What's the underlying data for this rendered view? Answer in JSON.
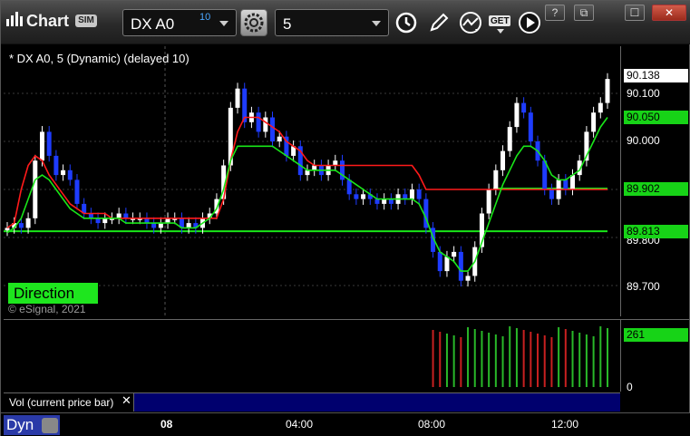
{
  "toolbar": {
    "title": "Chart",
    "sim_badge": "SIM",
    "symbol": "DX A0",
    "symbol_badge": "10",
    "interval": "5",
    "get_label": "GET",
    "window_buttons": [
      "?",
      "⧉",
      "☐",
      "✕"
    ]
  },
  "chart": {
    "label": "* DX A0, 5 (Dynamic) (delayed 10)",
    "copyright": "© eSignal, 2021",
    "direction_label": "Direction",
    "colors": {
      "up_bar": "#ffffff",
      "down_bar": "#1e3cff",
      "red_line": "#ff1a1a",
      "green_line": "#19e619",
      "grid": "#3a3a3a",
      "tag_green": "#17d317"
    }
  },
  "price_axis": {
    "ticks": [
      "90.100",
      "90.000",
      "89.900",
      "89.800",
      "89.700"
    ],
    "tick_values": [
      90.1,
      90.0,
      89.9,
      89.8,
      89.7
    ],
    "last_price_tag": "90.138",
    "last_price_value": 90.138,
    "green_tag_1": "90.050",
    "green_tag_1_value": 90.05,
    "green_tag_2": "89.902",
    "green_tag_2_value": 89.902,
    "green_tag_3": "89.813",
    "green_tag_3_value": 89.813
  },
  "volume": {
    "tag": "261",
    "zero_tick": "0"
  },
  "study_bar": {
    "label": "Vol (current price bar)",
    "close": "✕"
  },
  "time_axis": {
    "labels": [
      "08",
      "04:00",
      "08:00",
      "12:00"
    ],
    "dyn_label": "Dyn"
  },
  "chart_data": {
    "type": "candlestick",
    "symbol": "DX A0",
    "interval": "5",
    "x_ticks": [
      "08",
      "04:00",
      "08:00",
      "12:00"
    ],
    "y_ticks": [
      90.1,
      90.0,
      89.9,
      89.8,
      89.7
    ],
    "ylim": [
      89.65,
      90.18
    ],
    "close_path": [
      89.82,
      89.83,
      89.82,
      89.84,
      89.96,
      90.02,
      89.97,
      89.93,
      89.94,
      89.92,
      89.87,
      89.85,
      89.84,
      89.83,
      89.84,
      89.84,
      89.85,
      89.84,
      89.84,
      89.84,
      89.83,
      89.82,
      89.83,
      89.84,
      89.84,
      89.82,
      89.83,
      89.82,
      89.84,
      89.85,
      89.88,
      89.95,
      90.07,
      90.11,
      90.04,
      90.06,
      90.02,
      90.05,
      90.0,
      90.01,
      89.97,
      89.99,
      89.93,
      89.94,
      89.95,
      89.93,
      89.95,
      89.96,
      89.92,
      89.89,
      89.88,
      89.89,
      89.88,
      89.87,
      89.88,
      89.87,
      89.89,
      89.88,
      89.9,
      89.88,
      89.82,
      89.77,
      89.73,
      89.76,
      89.77,
      89.71,
      89.72,
      89.78,
      89.85,
      89.9,
      89.94,
      89.98,
      90.03,
      90.08,
      90.06,
      90.0,
      89.96,
      89.9,
      89.88,
      89.92,
      89.9,
      89.93,
      89.96,
      90.02,
      90.06,
      90.08,
      90.13
    ],
    "red_line": [
      89.82,
      89.83,
      89.9,
      89.95,
      89.97,
      89.96,
      89.93,
      89.91,
      89.89,
      89.87,
      89.86,
      89.85,
      89.85,
      89.85,
      89.85,
      89.84,
      89.84,
      89.84,
      89.84,
      89.84,
      89.84,
      89.84,
      89.84,
      89.84,
      89.84,
      89.84,
      89.84,
      89.84,
      89.84,
      89.84,
      89.84,
      89.88,
      89.96,
      90.02,
      90.05,
      90.05,
      90.05,
      90.04,
      90.03,
      90.02,
      90.0,
      89.99,
      89.98,
      89.96,
      89.95,
      89.95,
      89.95,
      89.95,
      89.95,
      89.95,
      89.95,
      89.95,
      89.95,
      89.95,
      89.95,
      89.95,
      89.95,
      89.95,
      89.95,
      89.93,
      89.9,
      89.9,
      89.9,
      89.9,
      89.9,
      89.9,
      89.9,
      89.9,
      89.9,
      89.9,
      89.9,
      89.9,
      89.9,
      89.9,
      89.9,
      89.9,
      89.9,
      89.9,
      89.9,
      89.9,
      89.9,
      89.9,
      89.9,
      89.9,
      89.9,
      89.9,
      89.9
    ],
    "green_line": [
      89.81,
      89.82,
      89.84,
      89.88,
      89.92,
      89.93,
      89.92,
      89.9,
      89.88,
      89.86,
      89.85,
      89.84,
      89.84,
      89.84,
      89.84,
      89.84,
      89.84,
      89.83,
      89.83,
      89.83,
      89.83,
      89.83,
      89.83,
      89.83,
      89.83,
      89.82,
      89.82,
      89.82,
      89.83,
      89.84,
      89.86,
      89.9,
      89.96,
      89.99,
      89.99,
      89.99,
      89.99,
      89.99,
      89.99,
      89.98,
      89.97,
      89.96,
      89.95,
      89.94,
      89.94,
      89.94,
      89.94,
      89.94,
      89.93,
      89.92,
      89.91,
      89.9,
      89.89,
      89.88,
      89.88,
      89.88,
      89.88,
      89.88,
      89.88,
      89.87,
      89.84,
      89.8,
      89.77,
      89.76,
      89.75,
      89.73,
      89.73,
      89.75,
      89.79,
      89.83,
      89.87,
      89.91,
      89.94,
      89.97,
      89.99,
      89.99,
      89.98,
      89.96,
      89.93,
      89.92,
      89.92,
      89.93,
      89.94,
      89.97,
      90.0,
      90.03,
      90.05
    ],
    "horizontal_lines": [
      89.902,
      89.813
    ],
    "volume_last": 261,
    "volume_range": [
      0,
      300
    ]
  }
}
